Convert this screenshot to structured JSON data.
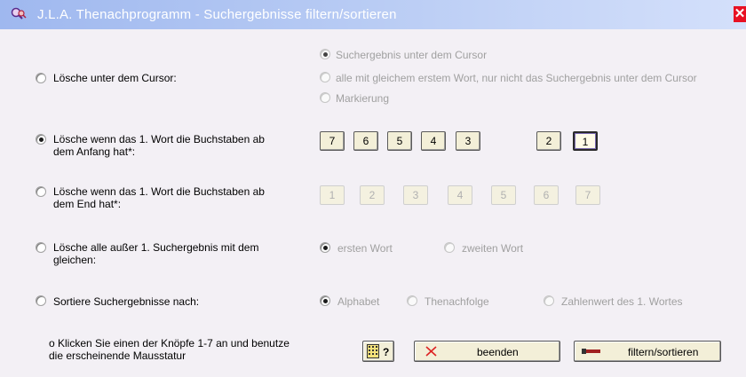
{
  "window": {
    "title": "J.L.A. Thenachprogramm - Suchergebnisse filtern/sortieren",
    "close_glyph": "✕"
  },
  "options": {
    "delete_under_cursor": {
      "label": "Lösche unter dem Cursor:",
      "checked": false,
      "sub": [
        {
          "label": "Suchergebnis unter dem Cursor",
          "checked": true
        },
        {
          "label": "alle mit gleichem erstem Wort, nur nicht das Suchergebnis unter dem Cursor",
          "checked": false
        },
        {
          "label": "Markierung",
          "checked": false
        }
      ]
    },
    "delete_first_word_start": {
      "label": "Lösche wenn das 1. Wort die Buchstaben ab dem Anfang hat*:",
      "checked": true,
      "buttons": [
        "7",
        "6",
        "5",
        "4",
        "3",
        "2",
        "1"
      ]
    },
    "delete_first_word_end": {
      "label": "Lösche wenn das 1. Wort die Buchstaben ab dem End hat*:",
      "checked": false,
      "buttons": [
        "1",
        "2",
        "3",
        "4",
        "5",
        "6",
        "7"
      ]
    },
    "delete_all_except": {
      "label": "Lösche alle außer 1. Suchergebnis mit dem gleichen:",
      "checked": false,
      "sub": [
        {
          "label": "ersten Wort",
          "checked": true
        },
        {
          "label": "zweiten Wort",
          "checked": false
        }
      ]
    },
    "sort_results": {
      "label": "Sortiere Suchergebnisse nach:",
      "checked": false,
      "sub": [
        {
          "label": "Alphabet",
          "checked": true
        },
        {
          "label": "Thenachfolge",
          "checked": false
        },
        {
          "label": "Zahlenwert des 1. Wortes",
          "checked": false
        }
      ]
    }
  },
  "footer": {
    "hint": "o  Klicken Sie einen der Knöpfe 1-7 an und benutze die erscheinende Mausstatur",
    "keyboard_button_label": "?",
    "close_button_label": "beenden",
    "filter_button_label": "filtern/sortieren"
  },
  "colors": {
    "titlebar": "#b4c8f2",
    "close": "#e81123",
    "body": "#f3f0f5",
    "button_face": "#f3efd8"
  },
  "icons": {
    "app": "magnifier-app-icon",
    "keyboard": "keyboard-icon",
    "close": "red-x-icon",
    "filter": "filter-pen-icon"
  }
}
